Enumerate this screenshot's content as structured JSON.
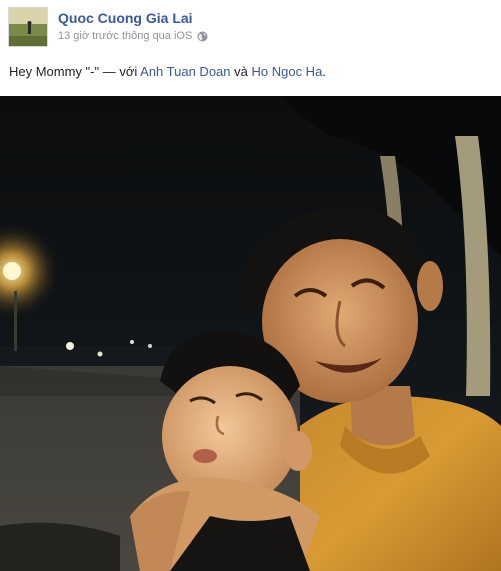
{
  "post": {
    "author": {
      "name": "Quoc Cuong Gia Lai",
      "avatar_icon": "profile-photo-icon"
    },
    "meta": {
      "timestamp": "13 giờ trước",
      "via": "thông qua iOS",
      "privacy_icon": "globe-icon"
    },
    "status": {
      "text": "Hey Mommy \"-\"",
      "separator": " — với ",
      "tagged_1": "Anh Tuan Doan",
      "conjunction": " và ",
      "tagged_2": "Ho Ngoc Ha",
      "end": "."
    }
  },
  "colors": {
    "link": "#3b5998",
    "meta": "#90949c",
    "text": "#1d2129"
  }
}
